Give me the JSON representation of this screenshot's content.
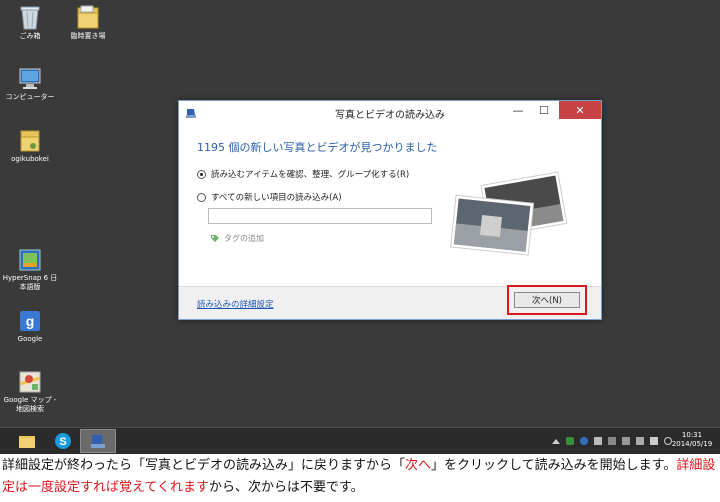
{
  "desktop": {
    "icons": [
      {
        "label": "ごみ箱"
      },
      {
        "label": "臨時置き場"
      },
      {
        "label": "コンピューター"
      },
      {
        "label": "ogikubokei"
      },
      {
        "label": "HyperSnap 6 日本語版"
      },
      {
        "label": "Google"
      },
      {
        "label": "Google マップ - 地図検索"
      }
    ]
  },
  "taskbar": {
    "clock_time": "10:31",
    "clock_date": "2014/05/19"
  },
  "dialog": {
    "title": "写真とビデオの読み込み",
    "heading": "1195 個の新しい写真とビデオが見つかりました",
    "option1": "読み込むアイテムを確認、整理、グループ化する(R)",
    "option2": "すべての新しい項目の読み込み(A)",
    "textbox_value": "",
    "tag_label": "タグの追加",
    "advanced_link": "読み込みの詳細設定",
    "next_button": "次へ(N)",
    "option1_selected": true
  },
  "caption": {
    "part1": "詳細設定が終わったら「写真とビデオの読み込み」に戻りますから「",
    "part2_red": "次へ",
    "part3": "」をクリックして読み込みを開始します。",
    "part4_red": "詳細設定は一度設定すれば覚えてくれます",
    "part5": "から、次からは不要です。"
  },
  "colors": {
    "highlight_red": "#e0141c",
    "heading_blue": "#2a5ea8"
  }
}
